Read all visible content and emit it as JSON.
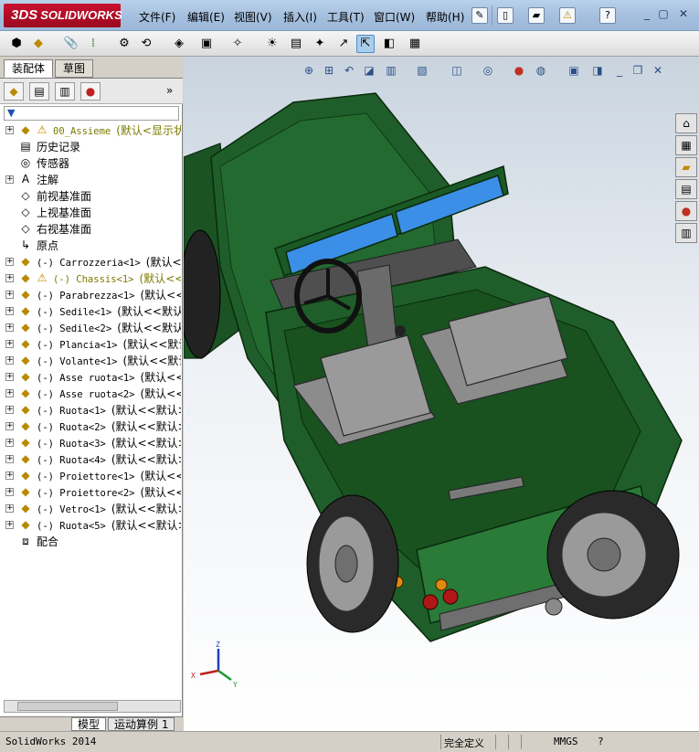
{
  "app": {
    "logo": "SOLIDWORKS",
    "logo_prefix": "3DS"
  },
  "menu": [
    "文件(F)",
    "编辑(E)",
    "视图(V)",
    "插入(I)",
    "工具(T)",
    "窗口(W)",
    "帮助(H)"
  ],
  "window_buttons": [
    "_",
    "▢",
    "✕"
  ],
  "left_pane": {
    "tabs": [
      "装配体",
      "草图"
    ],
    "tree": [
      {
        "label": "00_Assieme",
        "suffix": "(默认<显示状态",
        "icon": "assembly-icon",
        "warn": true,
        "expander": true,
        "olive": true,
        "mono": true
      },
      {
        "label": "历史记录",
        "icon": "history-icon",
        "expander": false
      },
      {
        "label": "传感器",
        "icon": "sensor-icon",
        "expander": false
      },
      {
        "label": "注解",
        "icon": "annotation-icon",
        "expander": true
      },
      {
        "label": "前视基准面",
        "icon": "plane-icon",
        "expander": false
      },
      {
        "label": "上视基准面",
        "icon": "plane-icon",
        "expander": false
      },
      {
        "label": "右视基准面",
        "icon": "plane-icon",
        "expander": false
      },
      {
        "label": "原点",
        "icon": "origin-icon",
        "expander": false
      },
      {
        "label": "(-) Carrozzeria<1>",
        "suffix": "(默认<<",
        "icon": "part-icon",
        "expander": true,
        "mono": true
      },
      {
        "label": "(-) Chassis<1>",
        "suffix": "(默认<<",
        "icon": "part-icon",
        "warn": true,
        "expander": true,
        "olive": true,
        "mono": true
      },
      {
        "label": "(-) Parabrezza<1>",
        "suffix": "(默认<<",
        "icon": "part-icon",
        "expander": true,
        "mono": true
      },
      {
        "label": "(-) Sedile<1>",
        "suffix": "(默认<<默认",
        "icon": "part-icon",
        "expander": true,
        "mono": true
      },
      {
        "label": "(-) Sedile<2>",
        "suffix": "(默认<<默认",
        "icon": "part-icon",
        "expander": true,
        "mono": true
      },
      {
        "label": "(-) Plancia<1>",
        "suffix": "(默认<<默认",
        "icon": "part-icon",
        "expander": true,
        "mono": true
      },
      {
        "label": "(-) Volante<1>",
        "suffix": "(默认<<默认",
        "icon": "part-icon",
        "expander": true,
        "mono": true
      },
      {
        "label": "(-) Asse ruota<1>",
        "suffix": "(默认<<",
        "icon": "part-icon",
        "expander": true,
        "mono": true
      },
      {
        "label": "(-) Asse ruota<2>",
        "suffix": "(默认<<",
        "icon": "part-icon",
        "expander": true,
        "mono": true
      },
      {
        "label": "(-) Ruota<1>",
        "suffix": "(默认<<默认>_",
        "icon": "part-icon",
        "expander": true,
        "mono": true
      },
      {
        "label": "(-) Ruota<2>",
        "suffix": "(默认<<默认>_",
        "icon": "part-icon",
        "expander": true,
        "mono": true
      },
      {
        "label": "(-) Ruota<3>",
        "suffix": "(默认<<默认>_",
        "icon": "part-icon",
        "expander": true,
        "mono": true
      },
      {
        "label": "(-) Ruota<4>",
        "suffix": "(默认<<默认>_",
        "icon": "part-icon",
        "expander": true,
        "mono": true
      },
      {
        "label": "(-) Proiettore<1>",
        "suffix": "(默认<<",
        "icon": "part-icon",
        "expander": true,
        "mono": true
      },
      {
        "label": "(-) Proiettore<2>",
        "suffix": "(默认<<",
        "icon": "part-icon",
        "expander": true,
        "mono": true
      },
      {
        "label": "(-) Vetro<1>",
        "suffix": "(默认<<默认>_",
        "icon": "part-icon",
        "expander": true,
        "mono": true
      },
      {
        "label": "(-) Ruota<5>",
        "suffix": "(默认<<默认>_",
        "icon": "part-icon",
        "expander": true,
        "mono": true
      },
      {
        "label": "配合",
        "icon": "mate-icon",
        "expander": false
      }
    ],
    "bottom_tabs": [
      "模型",
      "运动算例 1"
    ]
  },
  "viewport": {
    "triad": {
      "x": "X",
      "y": "Y",
      "z": "Z"
    },
    "colors": {
      "body": "#1f5e2a",
      "body_dark": "#134019",
      "glass": "#3b8fe6",
      "seat": "#8c8c8c",
      "tire": "#2a2a2a",
      "rim": "#9a9a9a"
    }
  },
  "status": {
    "app": "SolidWorks 2014",
    "state": "完全定义",
    "units": "MMGS",
    "help": "?"
  }
}
